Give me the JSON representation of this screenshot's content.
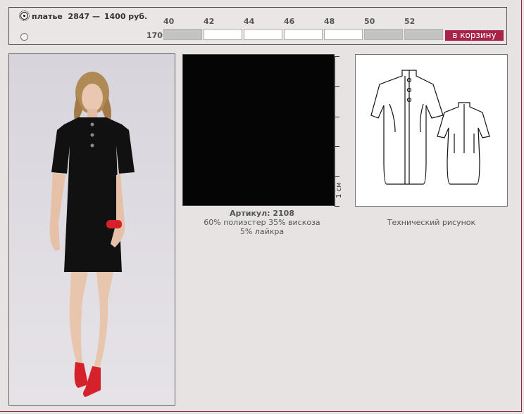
{
  "product": {
    "name": "платье",
    "model": "2847",
    "dash": "—",
    "price": "1400 руб."
  },
  "sizes": [
    {
      "label": "40",
      "available": false
    },
    {
      "label": "42",
      "available": true
    },
    {
      "label": "44",
      "available": true
    },
    {
      "label": "46",
      "available": true
    },
    {
      "label": "48",
      "available": true
    },
    {
      "label": "50",
      "available": false
    },
    {
      "label": "52",
      "available": false
    }
  ],
  "height_label": "170",
  "cart_label": "в корзину",
  "fabric": {
    "article_label": "Артикул: 2108",
    "composition_line1": "60% полиэстер 35% вискоза",
    "composition_line2": "5% лайкра",
    "ruler_label": "1 см"
  },
  "tech_caption": "Технический рисунок",
  "colors": {
    "accent": "#a72448",
    "unavailable": "#c3c3c3",
    "background": "#e8e3e3"
  }
}
